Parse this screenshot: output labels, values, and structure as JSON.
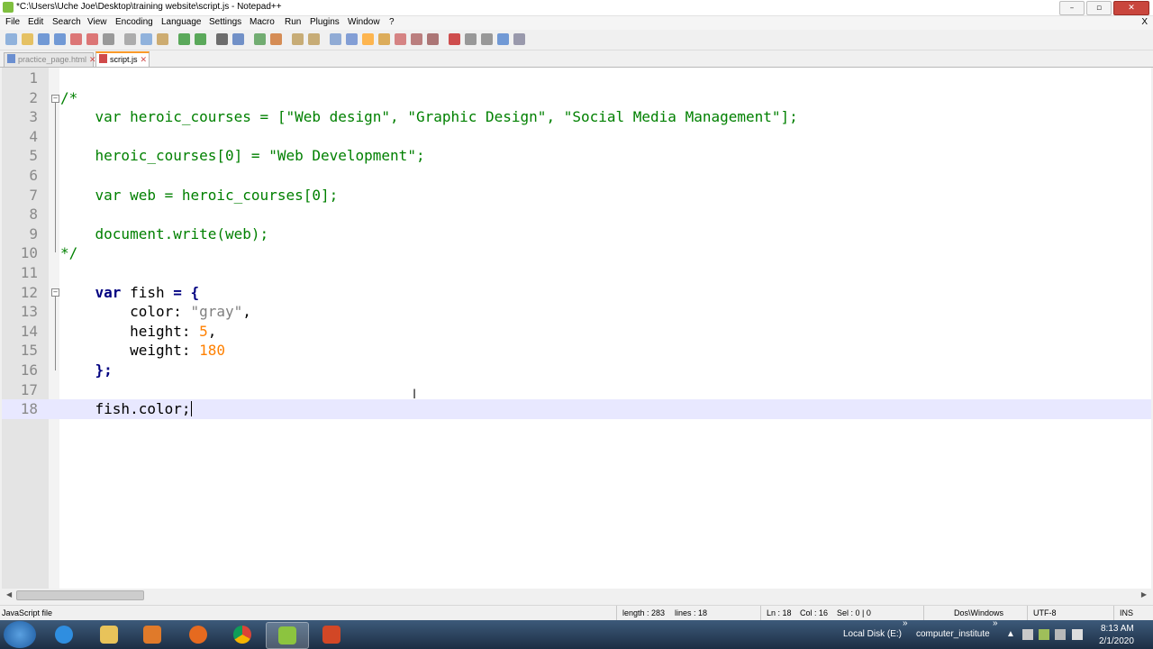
{
  "window": {
    "title": "*C:\\Users\\Uche Joe\\Desktop\\training website\\script.js - Notepad++",
    "buttons": [
      "–",
      "▫",
      "✕"
    ]
  },
  "menubar": {
    "items": [
      "File",
      "Edit",
      "Search",
      "View",
      "Encoding",
      "Language",
      "Settings",
      "Macro",
      "Run",
      "Plugins",
      "Window",
      "?"
    ],
    "close_label": "X"
  },
  "toolbar": {
    "icons": [
      "new-file-icon",
      "open-file-icon",
      "save-icon",
      "save-all-icon",
      "close-icon",
      "close-all-icon",
      "print-icon",
      "cut-icon",
      "copy-icon",
      "paste-icon",
      "undo-icon",
      "redo-icon",
      "find-icon",
      "replace-icon",
      "zoom-in-icon",
      "zoom-out-icon",
      "sync-vertical-icon",
      "sync-horizontal-icon",
      "word-wrap-icon",
      "show-all-chars-icon",
      "indent-guide-icon",
      "doc-map-icon",
      "function-list-icon",
      "folder-workspace-icon",
      "monitoring-icon",
      "record-macro-icon",
      "stop-macro-icon",
      "play-macro-icon",
      "run-macro-multiple-icon",
      "save-macro-icon"
    ]
  },
  "tabs": [
    {
      "label": "practice_page.html",
      "active": false
    },
    {
      "label": "script.js",
      "active": true
    }
  ],
  "editor": {
    "current_line": 18,
    "lines": [
      {
        "n": "1",
        "tokens": []
      },
      {
        "n": "2",
        "tokens": [
          {
            "t": "/*",
            "c": "cmt"
          }
        ]
      },
      {
        "n": "3",
        "tokens": [
          {
            "t": "    var heroic_courses = [\"Web design\", \"Graphic Design\", \"Social Media Management\"];",
            "c": "cmt"
          }
        ]
      },
      {
        "n": "4",
        "tokens": []
      },
      {
        "n": "5",
        "tokens": [
          {
            "t": "    heroic_courses[0] = \"Web Development\";",
            "c": "cmt"
          }
        ]
      },
      {
        "n": "6",
        "tokens": []
      },
      {
        "n": "7",
        "tokens": [
          {
            "t": "    var web = heroic_courses[0];",
            "c": "cmt"
          }
        ]
      },
      {
        "n": "8",
        "tokens": []
      },
      {
        "n": "9",
        "tokens": [
          {
            "t": "    document.write(web);",
            "c": "cmt"
          }
        ]
      },
      {
        "n": "10",
        "tokens": [
          {
            "t": "*/",
            "c": "cmt"
          }
        ]
      },
      {
        "n": "11",
        "tokens": []
      },
      {
        "n": "12",
        "tokens": [
          {
            "t": "    ",
            "c": ""
          },
          {
            "t": "var",
            "c": "kw"
          },
          {
            "t": " fish ",
            "c": ""
          },
          {
            "t": "=",
            "c": "op"
          },
          {
            "t": " ",
            "c": ""
          },
          {
            "t": "{",
            "c": "op"
          }
        ]
      },
      {
        "n": "13",
        "tokens": [
          {
            "t": "        color: ",
            "c": ""
          },
          {
            "t": "\"gray\"",
            "c": "str"
          },
          {
            "t": ",",
            "c": ""
          }
        ]
      },
      {
        "n": "14",
        "tokens": [
          {
            "t": "        height: ",
            "c": ""
          },
          {
            "t": "5",
            "c": "num"
          },
          {
            "t": ",",
            "c": ""
          }
        ]
      },
      {
        "n": "15",
        "tokens": [
          {
            "t": "        weight: ",
            "c": ""
          },
          {
            "t": "180",
            "c": "num"
          }
        ]
      },
      {
        "n": "16",
        "tokens": [
          {
            "t": "    ",
            "c": ""
          },
          {
            "t": "}",
            "c": "op"
          },
          {
            "t": ";",
            "c": "op"
          }
        ]
      },
      {
        "n": "17",
        "tokens": []
      },
      {
        "n": "18",
        "tokens": [
          {
            "t": "    fish.color;",
            "c": ""
          }
        ]
      }
    ]
  },
  "statusbar": {
    "file_type": "JavaScript file",
    "length": "length : 283",
    "lines": "lines : 18",
    "ln": "Ln : 18",
    "col": "Col : 16",
    "sel": "Sel : 0 | 0",
    "eol": "Dos\\Windows",
    "encoding": "UTF-8",
    "mode": "INS"
  },
  "taskbar": {
    "apps": [
      "internet-explorer-icon",
      "file-explorer-icon",
      "media-player-icon",
      "firefox-icon",
      "chrome-icon",
      "notepadpp-icon",
      "powerpoint-icon"
    ],
    "toolbar1": "Local Disk (E:)",
    "toolbar2": "computer_institute",
    "chevron": "»",
    "time": "8:13 AM",
    "date": "2/1/2020"
  },
  "colors": {
    "comment": "#008000",
    "keyword": "#000080",
    "string": "#808080",
    "number": "#ff8000",
    "current_line": "#e8e8ff",
    "tab_accent": "#fa9a28"
  }
}
